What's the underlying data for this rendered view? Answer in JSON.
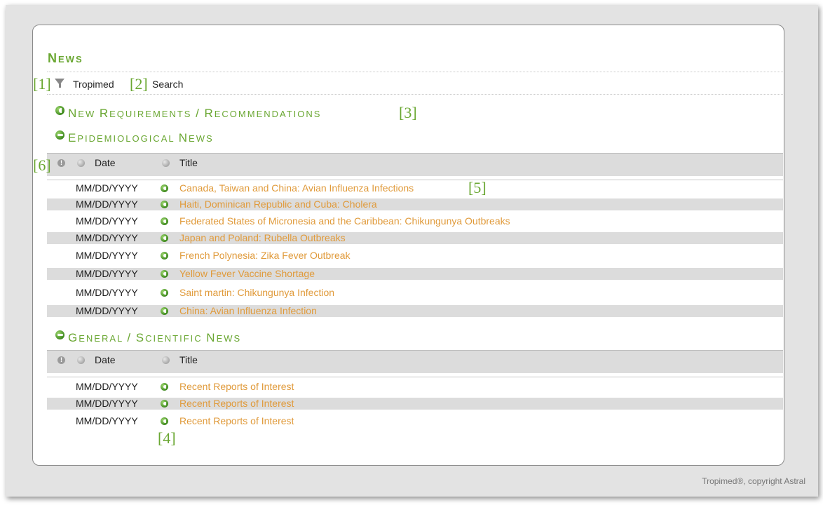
{
  "header": {
    "title": "News"
  },
  "toolbar": {
    "tropimed_label": "Tropimed",
    "search_label": "Search"
  },
  "annotations": [
    "[1]",
    "[2]",
    "[3]",
    "[4]",
    "[5]",
    "[6]"
  ],
  "sections": {
    "requirements": "New Requirements / Recommendations",
    "epidemiological": "Epidemiological News",
    "general": "General / Scientific news"
  },
  "table_headers": {
    "date": "Date",
    "title": "Title"
  },
  "epidemiological_rows": [
    {
      "date": "MM/DD/YYYY",
      "title": "Canada, Taiwan and China: Avian Influenza Infections"
    },
    {
      "date": "MM/DD/YYYY",
      "title": "Haiti, Dominican Republic and Cuba: Cholera"
    },
    {
      "date": "MM/DD/YYYY",
      "title": "Federated States of Micronesia and the Caribbean: Chikungunya Outbreaks"
    },
    {
      "date": "MM/DD/YYYY",
      "title": "Japan and Poland: Rubella Outbreaks"
    },
    {
      "date": "MM/DD/YYYY",
      "title": "French Polynesia: Zika Fever Outbreak"
    },
    {
      "date": "MM/DD/YYYY",
      "title": "Yellow Fever Vaccine Shortage"
    },
    {
      "date": "MM/DD/YYYY",
      "title": "Saint martin: Chikungunya Infection"
    },
    {
      "date": "MM/DD/YYYY",
      "title": "China: Avian Influenza Infection"
    }
  ],
  "general_rows": [
    {
      "date": "MM/DD/YYYY",
      "title": "Recent Reports of Interest"
    },
    {
      "date": "MM/DD/YYYY",
      "title": "Recent Reports of Interest"
    },
    {
      "date": "MM/DD/YYYY",
      "title": "Recent Reports of Interest"
    }
  ],
  "footer": {
    "copyright": "Tropimed®, copyright Astral"
  },
  "colors": {
    "accent": "#6aa732",
    "link": "#e09a3a",
    "row_alt": "#dcdcdc"
  }
}
